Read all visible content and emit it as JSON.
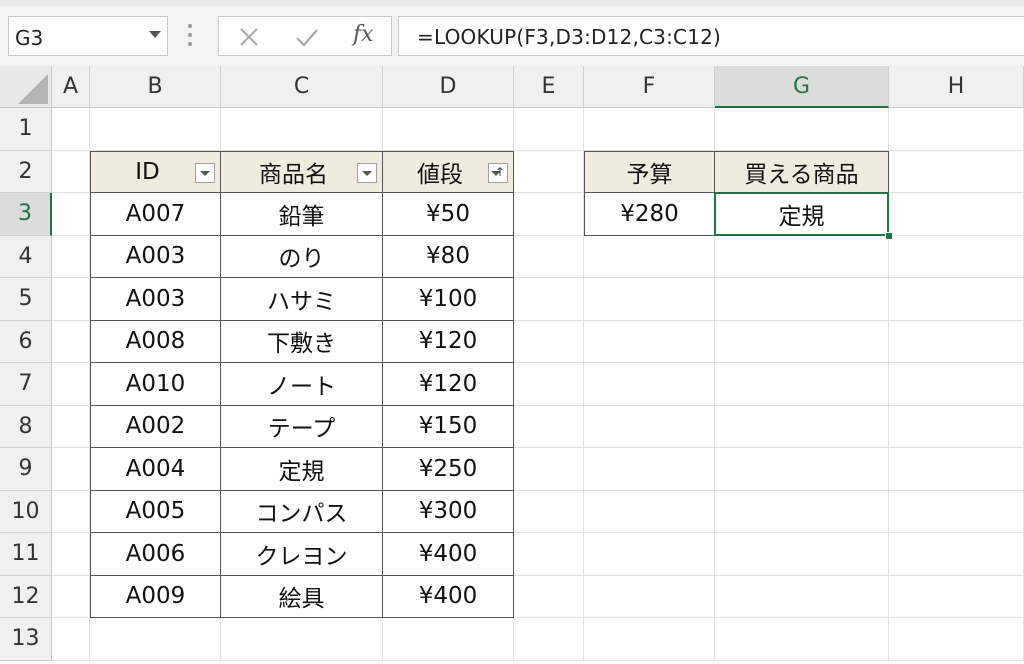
{
  "name_box": {
    "value": "G3"
  },
  "formula_bar": {
    "fx_label": "fx",
    "formula": "=LOOKUP(F3,D3:D12,C3:C12)"
  },
  "columns": [
    "A",
    "B",
    "C",
    "D",
    "E",
    "F",
    "G",
    "H"
  ],
  "rows": [
    "1",
    "2",
    "3",
    "4",
    "5",
    "6",
    "7",
    "8",
    "9",
    "10",
    "11",
    "12",
    "13"
  ],
  "selected_column": "G",
  "selected_row": "3",
  "product_table": {
    "headers": [
      "ID",
      "商品名",
      "値段"
    ],
    "rows": [
      [
        "A007",
        "鉛筆",
        "¥50"
      ],
      [
        "A003",
        "のり",
        "¥80"
      ],
      [
        "A003",
        "ハサミ",
        "¥100"
      ],
      [
        "A008",
        "下敷き",
        "¥120"
      ],
      [
        "A010",
        "ノート",
        "¥120"
      ],
      [
        "A002",
        "テープ",
        "¥150"
      ],
      [
        "A004",
        "定規",
        "¥250"
      ],
      [
        "A005",
        "コンパス",
        "¥300"
      ],
      [
        "A006",
        "クレヨン",
        "¥400"
      ],
      [
        "A009",
        "絵具",
        "¥400"
      ]
    ]
  },
  "result_table": {
    "headers": [
      "予算",
      "買える商品"
    ],
    "values": [
      "¥280",
      "定規"
    ]
  },
  "colors": {
    "header_fill": "#efebde",
    "selection_accent": "#217346"
  },
  "icons": {
    "cancel": "close-icon",
    "enter": "checkmark-icon",
    "dropdown": "chevron-down-icon"
  }
}
